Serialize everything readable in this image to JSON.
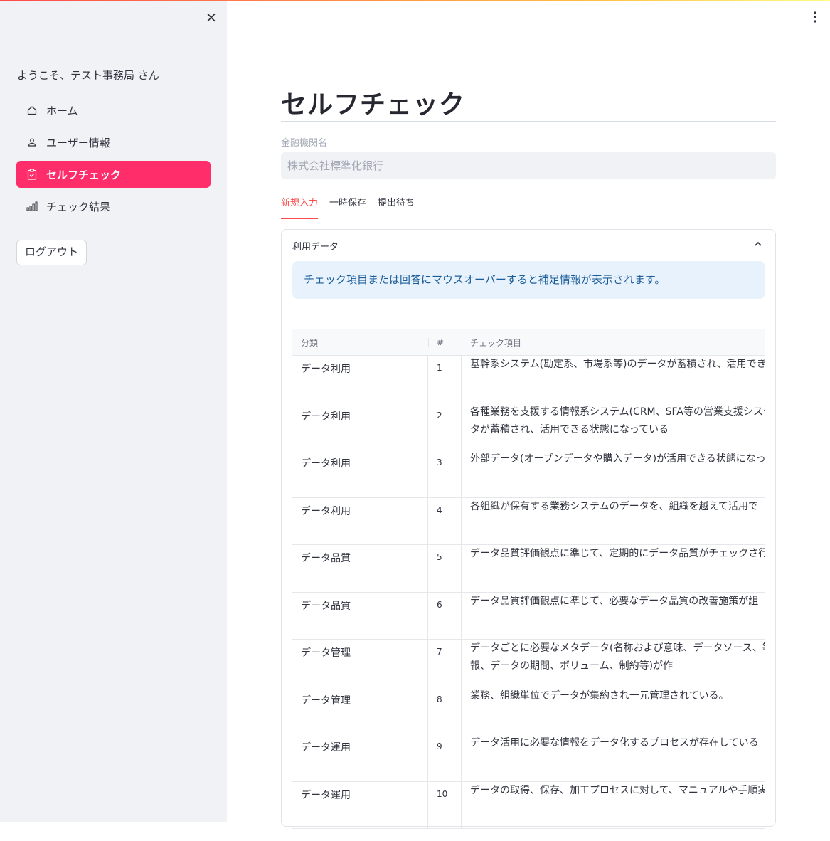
{
  "sidebar": {
    "welcome": "ようこそ、テスト事務局 さん",
    "items": [
      {
        "label": "ホーム",
        "icon": "home-icon"
      },
      {
        "label": "ユーザー情報",
        "icon": "user-icon"
      },
      {
        "label": "セルフチェック",
        "icon": "clipboard-check-icon",
        "active": true
      },
      {
        "label": "チェック結果",
        "icon": "bar-chart-icon"
      }
    ],
    "logout": "ログアウト",
    "close": "×"
  },
  "main": {
    "title": "セルフチェック",
    "institution_label": "金融機関名",
    "institution_value": "株式会社標準化銀行",
    "tabs": [
      {
        "label": "新規入力",
        "active": true
      },
      {
        "label": "一時保存"
      },
      {
        "label": "提出待ち"
      }
    ],
    "expander_title": "利用データ",
    "info_message": "チェック項目または回答にマウスオーバーすると補足情報が表示されます。",
    "table": {
      "headers": [
        "分類",
        "#",
        "チェック項目"
      ],
      "rows": [
        {
          "category": "データ利用",
          "num": "1",
          "item": "基幹系システム(勘定系、市場系等)のデータが蓄積され、活用でき"
        },
        {
          "category": "データ利用",
          "num": "2",
          "item": "各種業務を支援する情報系システム(CRM、SFA等の営業支援システ理システム等)のデータが蓄積され、活用できる状態になっている"
        },
        {
          "category": "データ利用",
          "num": "3",
          "item": "外部データ(オープンデータや購入データ)が活用できる状態になっ"
        },
        {
          "category": "データ利用",
          "num": "4",
          "item": "各組織が保有する業務システムのデータを、組織を越えて活用で"
        },
        {
          "category": "データ品質",
          "num": "5",
          "item": "データ品質評価観点に準じて、定期的にデータ品質がチェックさ行われている。"
        },
        {
          "category": "データ品質",
          "num": "6",
          "item": "データ品質評価観点に準じて、必要なデータ品質の改善施策が組"
        },
        {
          "category": "データ管理",
          "num": "7",
          "item": "データごとに必要なメタデータ(名称および意味、データソース、等の業務に関する情報、データの期間、ボリューム、制約等)が作"
        },
        {
          "category": "データ管理",
          "num": "8",
          "item": "業務、組織単位でデータが集約され一元管理されている。"
        },
        {
          "category": "データ運用",
          "num": "9",
          "item": "データ活用に必要な情報をデータ化するプロセスが存在している"
        },
        {
          "category": "データ運用",
          "num": "10",
          "item": "データの取得、保存、加工プロセスに対して、マニュアルや手順実施されている"
        }
      ]
    }
  },
  "colors": {
    "accent": "#ff2e6a",
    "info_bg": "#e8f2fc",
    "info_text": "#1c5d99",
    "sidebar_bg": "#f0f2f6"
  }
}
